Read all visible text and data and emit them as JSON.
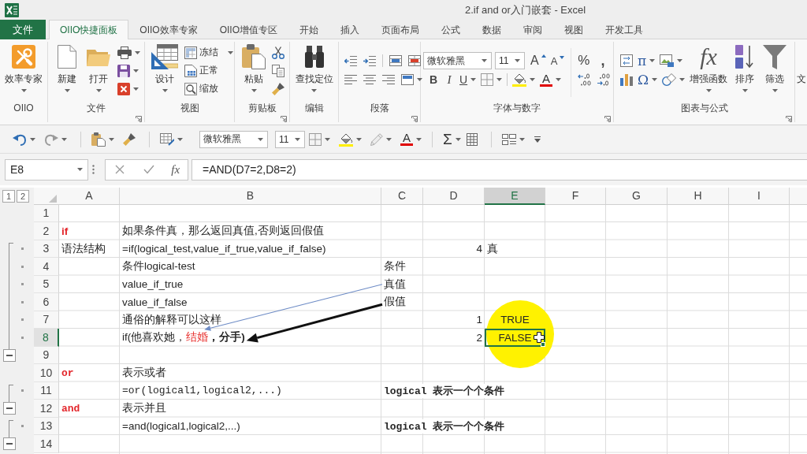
{
  "window": {
    "title": "2.if and or入门嵌套 - Excel"
  },
  "ribbon_tabs": [
    {
      "label": "文件",
      "kind": "file",
      "selected": false
    },
    {
      "label": "OIIO快捷面板",
      "kind": "tab",
      "selected": true
    },
    {
      "label": "OIIO效率专家",
      "kind": "tab",
      "selected": false
    },
    {
      "label": "OIIO增值专区",
      "kind": "tab",
      "selected": false
    },
    {
      "label": "开始",
      "kind": "tab",
      "selected": false
    },
    {
      "label": "插入",
      "kind": "tab",
      "selected": false
    },
    {
      "label": "页面布局",
      "kind": "tab",
      "selected": false
    },
    {
      "label": "公式",
      "kind": "tab",
      "selected": false
    },
    {
      "label": "数据",
      "kind": "tab",
      "selected": false
    },
    {
      "label": "审阅",
      "kind": "tab",
      "selected": false
    },
    {
      "label": "视图",
      "kind": "tab",
      "selected": false
    },
    {
      "label": "开发工具",
      "kind": "tab",
      "selected": false
    }
  ],
  "ribbon_groups": [
    {
      "kind": "oiio",
      "label": "OIIO",
      "launcher": false,
      "buttons": [
        {
          "label": "效率专家",
          "dropdown": true
        }
      ]
    },
    {
      "kind": "file",
      "label": "文件",
      "launcher": true,
      "buttons": [
        {
          "label": "新建",
          "dropdown": true
        },
        {
          "label": "打开",
          "dropdown": true
        }
      ]
    },
    {
      "kind": "view",
      "label": "视图",
      "launcher": false,
      "buttons": [
        {
          "label": "设计",
          "dropdown": true
        }
      ],
      "small_buttons": [
        {
          "label": "冻结",
          "dropdown": true
        },
        {
          "label": "正常",
          "dropdown": false
        },
        {
          "label": "缩放",
          "dropdown": false
        }
      ]
    },
    {
      "kind": "clipboard",
      "label": "剪贴板",
      "launcher": true,
      "buttons": [
        {
          "label": "粘贴",
          "dropdown": true
        }
      ]
    },
    {
      "kind": "edit",
      "label": "编辑",
      "launcher": false,
      "buttons": [
        {
          "label": "查找定位",
          "dropdown": true
        }
      ]
    },
    {
      "kind": "paragraph",
      "label": "段落",
      "launcher": true
    },
    {
      "kind": "font",
      "label": "字体与数字",
      "launcher": true,
      "font": "微软雅黑",
      "size": "11",
      "size_keys": [
        "A",
        "A"
      ],
      "number_keys": [
        "%",
        ","
      ],
      "style_keys": [
        "B",
        "I",
        "U"
      ],
      "font_color_key": "A"
    },
    {
      "kind": "charts",
      "label": "图表与公式",
      "launcher": true,
      "symbols": [
        "π",
        "Ω"
      ],
      "buttons": [
        {
          "label": "增强函数",
          "glyph": "fx",
          "dropdown": true
        },
        {
          "label": "排序",
          "dropdown": true
        },
        {
          "label": "筛选",
          "dropdown": true
        }
      ]
    },
    {
      "kind": "partial",
      "buttons": [
        {
          "label": "文",
          "dropdown": false
        }
      ]
    }
  ],
  "quick_access": {
    "font": "微软雅黑",
    "size": "11",
    "font_color_key": "A",
    "sum_key": "Σ"
  },
  "formula_bar": {
    "name_box": "E8",
    "function_key": "fx",
    "formula": "=AND(D7=2,D8=2)"
  },
  "sheet": {
    "outline_levels": [
      "1",
      "2"
    ],
    "columns": [
      {
        "label": "A",
        "selected": false
      },
      {
        "label": "B",
        "selected": false
      },
      {
        "label": "C",
        "selected": false
      },
      {
        "label": "D",
        "selected": false
      },
      {
        "label": "E",
        "selected": true
      },
      {
        "label": "F",
        "selected": false
      },
      {
        "label": "G",
        "selected": false
      },
      {
        "label": "H",
        "selected": false
      },
      {
        "label": "I",
        "selected": false
      }
    ],
    "rows": [
      {
        "number": "1",
        "selected": false,
        "grouped": false
      },
      {
        "number": "2",
        "selected": false,
        "grouped": false,
        "cells": {
          "column_a": {
            "kind": "text",
            "text": "if",
            "emphasis": true,
            "color": "#e3262b"
          },
          "column_b": {
            "kind": "text",
            "text": "如果条件真，那么返回真值,否则返回假值"
          }
        }
      },
      {
        "number": "3",
        "selected": false,
        "grouped": true,
        "cells": {
          "column_a": {
            "kind": "text",
            "text": "语法结构"
          },
          "column_b": {
            "kind": "text",
            "text": "=if(logical_test,value_if_true,value_if_false)"
          },
          "column_d": {
            "kind": "number",
            "text": "4"
          },
          "column_e": {
            "kind": "text",
            "text": "真"
          }
        }
      },
      {
        "number": "4",
        "selected": false,
        "grouped": true,
        "cells": {
          "column_b": {
            "kind": "text",
            "text": "条件logical-test"
          },
          "column_c": {
            "kind": "text",
            "text": "条件"
          }
        }
      },
      {
        "number": "5",
        "selected": false,
        "grouped": true,
        "cells": {
          "column_b": {
            "kind": "text",
            "text": "value_if_true"
          },
          "column_c": {
            "kind": "text",
            "text": "真值"
          }
        }
      },
      {
        "number": "6",
        "selected": false,
        "grouped": true,
        "cells": {
          "column_b": {
            "kind": "text",
            "text": "value_if_false"
          },
          "column_c": {
            "kind": "text",
            "text": "假值"
          }
        }
      },
      {
        "number": "7",
        "selected": false,
        "grouped": true,
        "cells": {
          "column_b": {
            "kind": "text",
            "text": "通俗的解释可以这样"
          },
          "column_d": {
            "kind": "number",
            "text": "1"
          },
          "column_e": {
            "kind": "boolean",
            "text": "TRUE"
          }
        }
      },
      {
        "number": "8",
        "selected": true,
        "grouped": true,
        "cells": {
          "column_b": {
            "kind": "text",
            "runs": [
              {
                "text": "if(他喜欢她，"
              },
              {
                "text": "结婚",
                "color": "#e8312f"
              },
              {
                "text": "，分手)",
                "emphasis": true
              }
            ]
          },
          "column_d": {
            "kind": "number",
            "text": "2"
          },
          "column_e": {
            "kind": "boolean",
            "text": "FALSE"
          }
        }
      },
      {
        "number": "9",
        "selected": false,
        "grouped": false,
        "group_toggle": {
          "expanded": true
        }
      },
      {
        "number": "10",
        "selected": false,
        "grouped": false,
        "cells": {
          "column_a": {
            "kind": "code",
            "text": "or",
            "emphasis": true,
            "color": "#e3262b"
          },
          "column_b": {
            "kind": "text",
            "text": "表示或者"
          }
        }
      },
      {
        "number": "11",
        "selected": false,
        "grouped": true,
        "cells": {
          "column_b": {
            "kind": "code",
            "text": "=or(logical1,logical2,...)"
          },
          "column_c": {
            "kind": "code",
            "text": "logical 表示一个个条件",
            "emphasis": true
          }
        }
      },
      {
        "number": "12",
        "selected": false,
        "grouped": false,
        "group_toggle": {
          "expanded": true
        },
        "cells": {
          "column_a": {
            "kind": "code",
            "text": "and",
            "emphasis": true,
            "color": "#e3262b"
          },
          "column_b": {
            "kind": "text",
            "text": "表示并且"
          }
        }
      },
      {
        "number": "13",
        "selected": false,
        "grouped": true,
        "cells": {
          "column_b": {
            "kind": "text",
            "text": "=and(logical1,logical2,...)"
          },
          "column_c": {
            "kind": "code",
            "text": "logical 表示一个个条件",
            "emphasis": true
          }
        }
      },
      {
        "number": "14",
        "selected": false,
        "grouped": false,
        "group_toggle": {
          "expanded": true
        }
      }
    ]
  }
}
